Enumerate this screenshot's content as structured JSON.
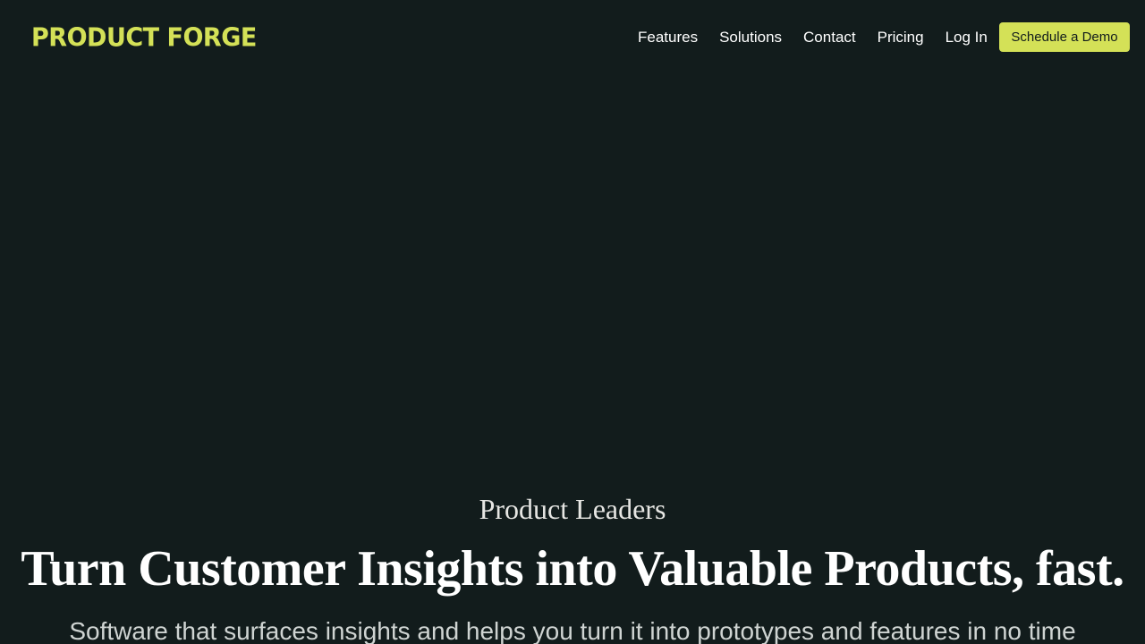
{
  "header": {
    "logo_text": "PRODUCT FORGE",
    "nav": [
      {
        "label": "Features"
      },
      {
        "label": "Solutions"
      },
      {
        "label": "Contact"
      },
      {
        "label": "Pricing"
      },
      {
        "label": "Log In"
      }
    ],
    "cta_label": "Schedule a Demo"
  },
  "hero": {
    "eyebrow": "Product Leaders",
    "headline": "Turn Customer Insights into Valuable Products, fast.",
    "subhead": "Software that surfaces insights and helps you turn it into prototypes and features in no time"
  },
  "colors": {
    "background": "#121c1c",
    "accent": "#d4e157",
    "text": "#ffffff"
  }
}
